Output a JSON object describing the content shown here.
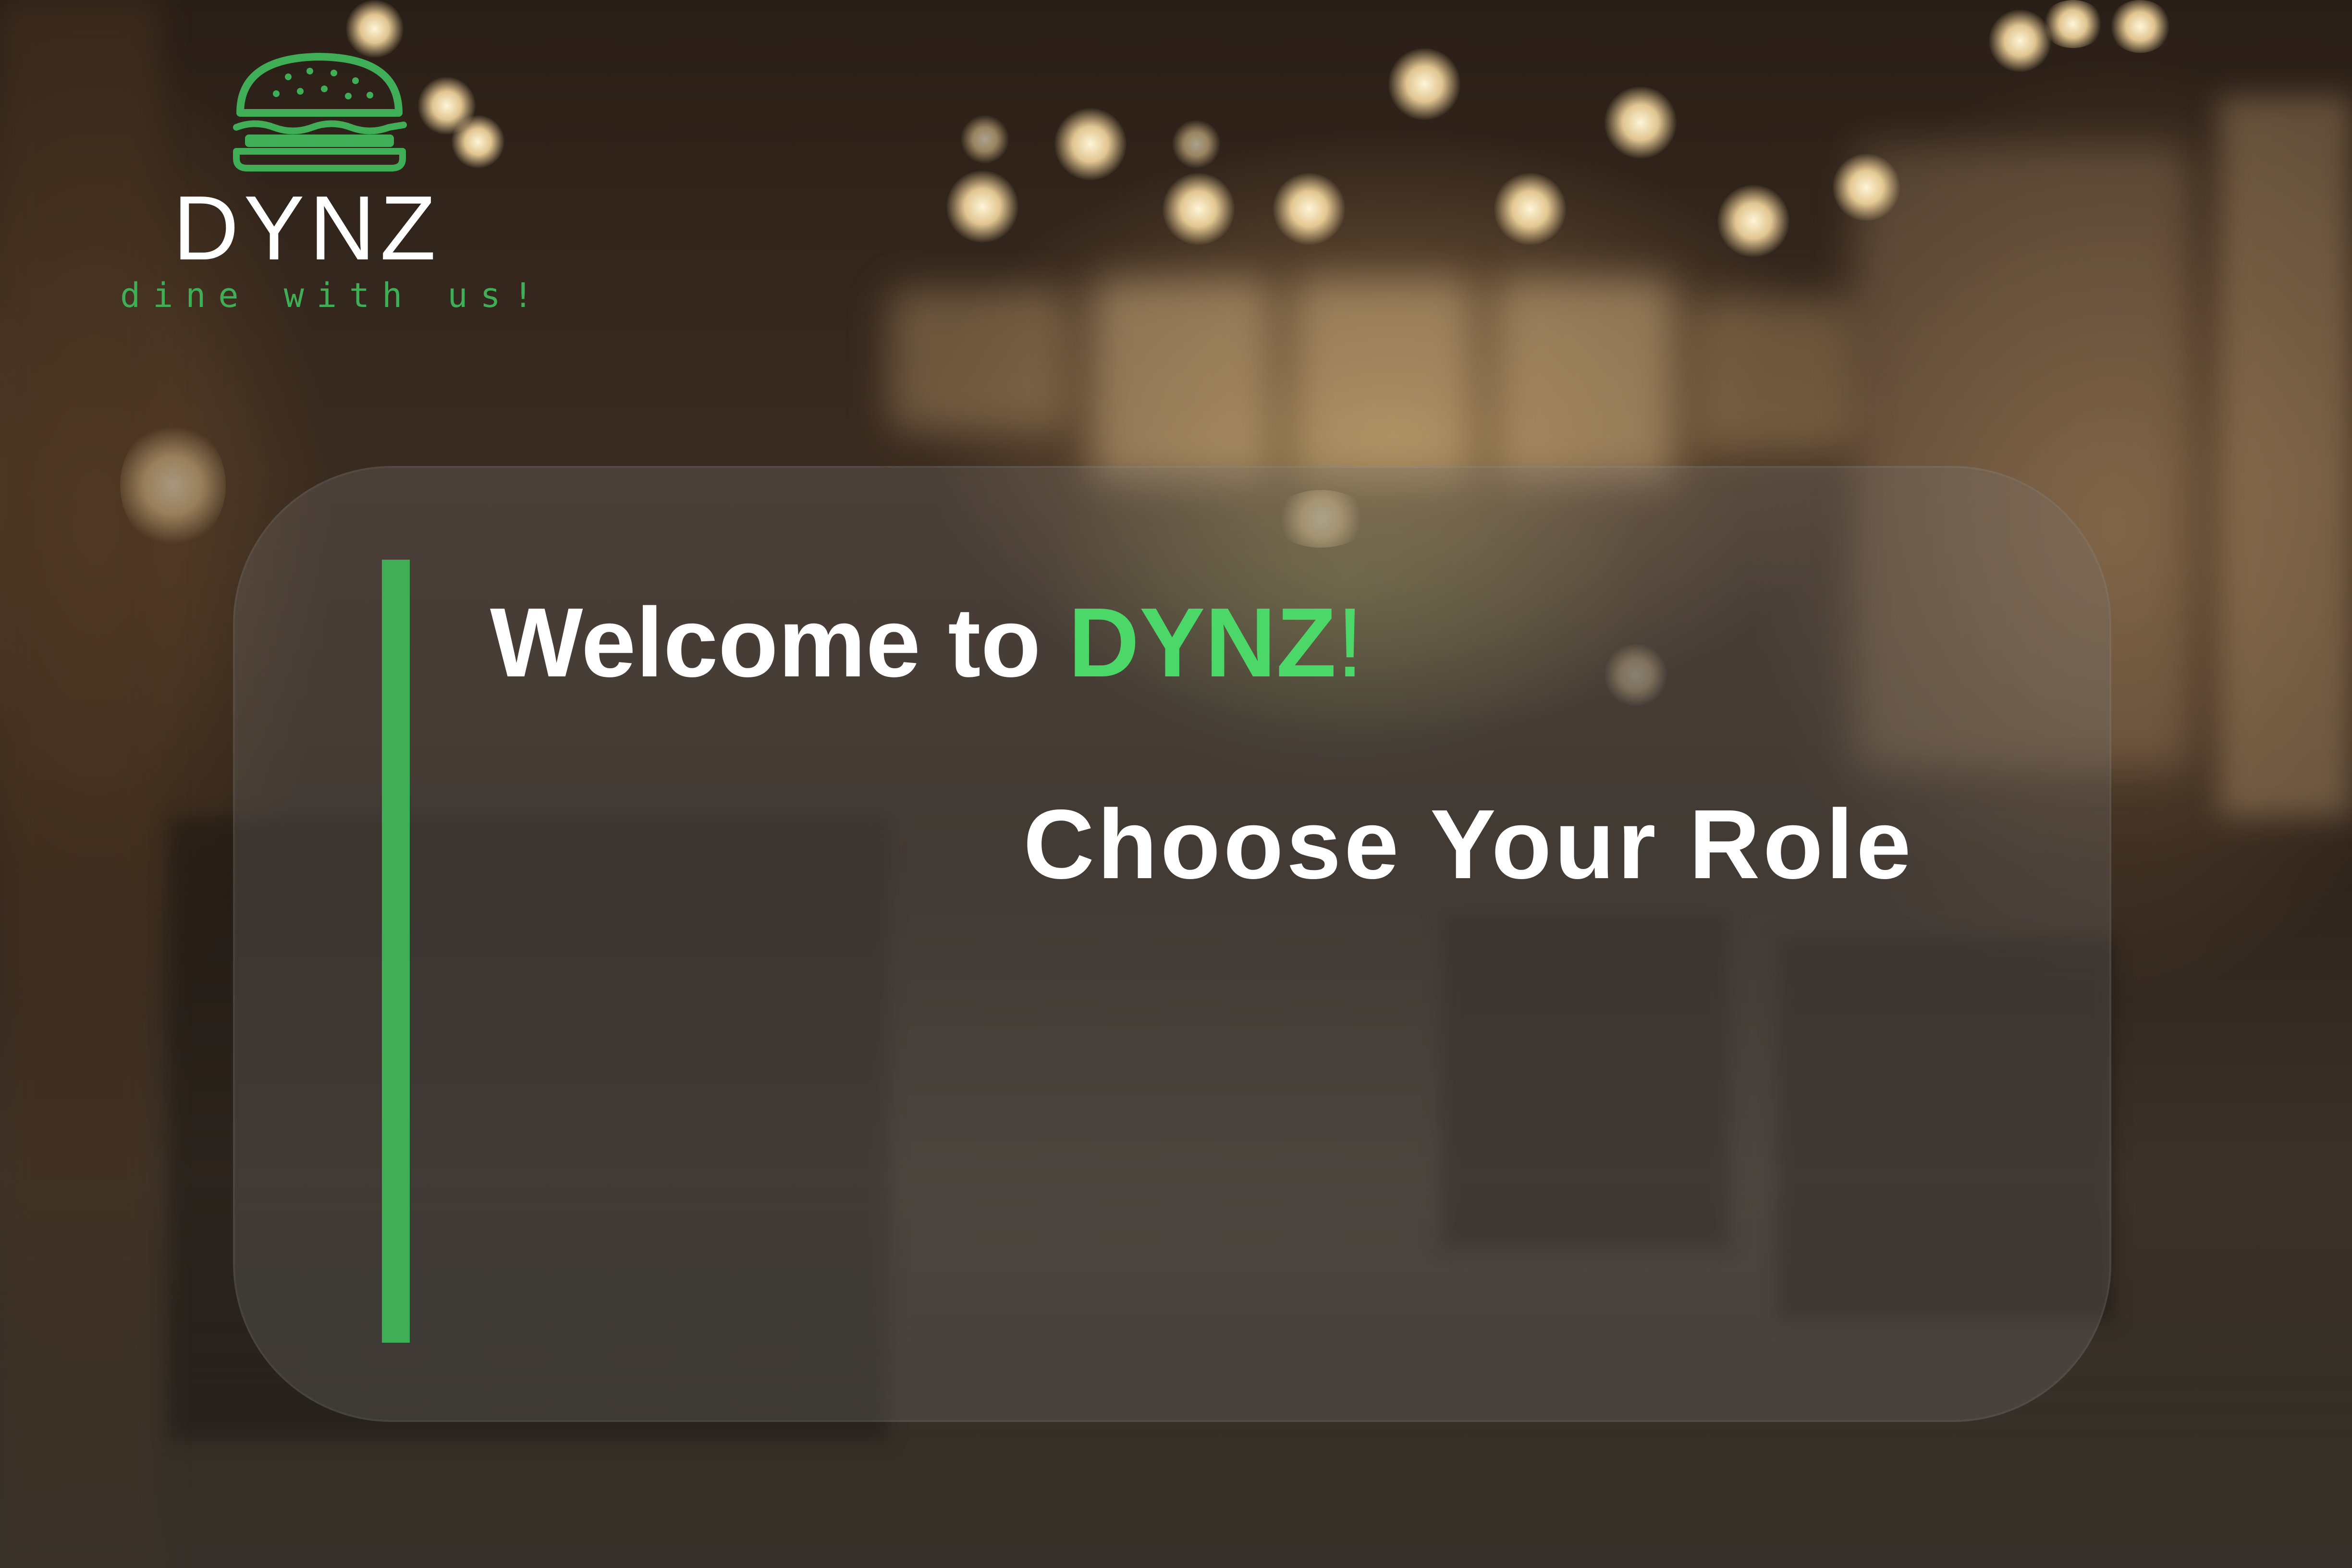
{
  "logo": {
    "name": "DYNZ",
    "tagline": "dine with us!",
    "icon": "burger-icon",
    "color": "#3fae57"
  },
  "welcome": {
    "prefix": "Welcome to ",
    "brand": "DYNZ",
    "suffix": "!"
  },
  "subtitle": "Choose Your Role",
  "colors": {
    "accent": "#3fae57",
    "brand_text": "#4cd868",
    "text": "#ffffff"
  }
}
